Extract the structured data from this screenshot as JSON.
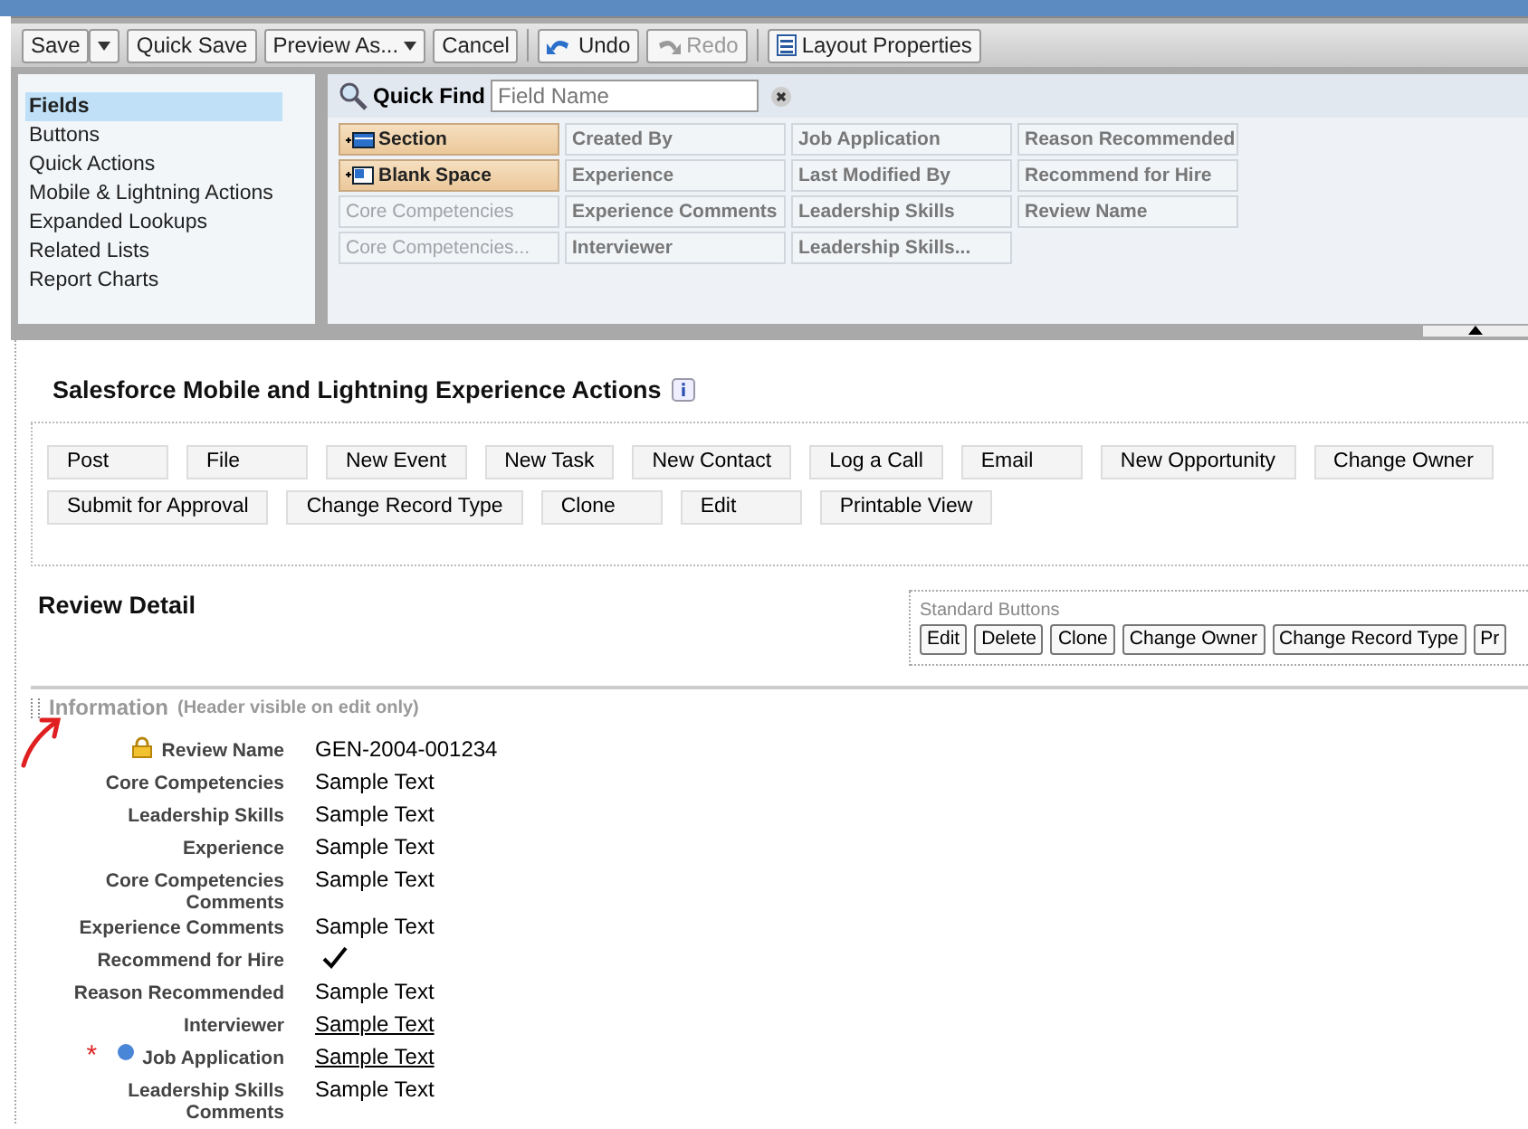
{
  "toolbar": [
    {
      "label": "Save",
      "kind": "split"
    },
    {
      "label": "Quick Save",
      "kind": "plain"
    },
    {
      "label": "Preview As...",
      "kind": "menu"
    },
    {
      "label": "Cancel",
      "kind": "plain"
    },
    {
      "label": "Undo",
      "kind": "undo",
      "disabled": false
    },
    {
      "label": "Redo",
      "kind": "redo",
      "disabled": true
    },
    {
      "label": "Layout Properties",
      "kind": "props"
    }
  ],
  "palette_categories": [
    {
      "label": "Fields",
      "selected": true
    },
    {
      "label": "Buttons",
      "selected": false
    },
    {
      "label": "Quick Actions",
      "selected": false
    },
    {
      "label": "Mobile & Lightning Actions",
      "selected": false
    },
    {
      "label": "Expanded Lookups",
      "selected": false
    },
    {
      "label": "Related Lists",
      "selected": false
    },
    {
      "label": "Report Charts",
      "selected": false
    }
  ],
  "quick_find": {
    "label": "Quick Find",
    "placeholder": "Field Name"
  },
  "palette_columns": [
    [
      {
        "label": "Section",
        "kind": "section",
        "used": false
      },
      {
        "label": "Blank Space",
        "kind": "blank",
        "used": false
      },
      {
        "label": "Core Competencies",
        "kind": "field",
        "used": true
      },
      {
        "label": "Core Competencies...",
        "kind": "field",
        "used": true
      }
    ],
    [
      {
        "label": "Created By",
        "kind": "field",
        "used": false
      },
      {
        "label": "Experience",
        "kind": "field",
        "used": false
      },
      {
        "label": "Experience Comments",
        "kind": "field",
        "used": false
      },
      {
        "label": "Interviewer",
        "kind": "field",
        "used": false
      }
    ],
    [
      {
        "label": "Job Application",
        "kind": "field",
        "used": false
      },
      {
        "label": "Last Modified By",
        "kind": "field",
        "used": false
      },
      {
        "label": "Leadership Skills",
        "kind": "field",
        "used": false
      },
      {
        "label": "Leadership Skills...",
        "kind": "field",
        "used": false
      }
    ],
    [
      {
        "label": "Reason Recommended",
        "kind": "field",
        "used": false
      },
      {
        "label": "Recommend for Hire",
        "kind": "field",
        "used": false
      },
      {
        "label": "Review Name",
        "kind": "field",
        "used": false
      }
    ]
  ],
  "actions": {
    "title": "Salesforce Mobile and Lightning Experience Actions",
    "buttons": [
      "Post",
      "File",
      "New Event",
      "New Task",
      "New Contact",
      "Log a Call",
      "Email",
      "New Opportunity",
      "Change Owner",
      "Submit for Approval",
      "Change Record Type",
      "Clone",
      "Edit",
      "Printable View"
    ]
  },
  "detail": {
    "title": "Review Detail",
    "standard_buttons_label": "Standard Buttons",
    "standard_buttons": [
      "Edit",
      "Delete",
      "Clone",
      "Change Owner",
      "Change Record Type",
      "Pr"
    ]
  },
  "section": {
    "title": "Information",
    "note": "(Header visible on edit only)"
  },
  "fields": [
    {
      "label": "Review Name",
      "value": "GEN-2004-001234",
      "kind": "text",
      "locked": true,
      "required": false
    },
    {
      "label": "Core Competencies",
      "value": "Sample Text",
      "kind": "text",
      "locked": false,
      "required": false
    },
    {
      "label": "Leadership Skills",
      "value": "Sample Text",
      "kind": "text",
      "locked": false,
      "required": false
    },
    {
      "label": "Experience",
      "value": "Sample Text",
      "kind": "text",
      "locked": false,
      "required": false
    },
    {
      "label": "Core Competencies Comments",
      "value": "Sample Text",
      "kind": "text",
      "locked": false,
      "required": false
    },
    {
      "label": "Experience Comments",
      "value": "Sample Text",
      "kind": "text",
      "locked": false,
      "required": false
    },
    {
      "label": "Recommend for Hire",
      "kind": "checkbox",
      "checked": true,
      "locked": false,
      "required": false
    },
    {
      "label": "Reason Recommended",
      "value": "Sample Text",
      "kind": "text",
      "locked": false,
      "required": false
    },
    {
      "label": "Interviewer",
      "value": "Sample Text",
      "kind": "link",
      "locked": false,
      "required": false
    },
    {
      "label": "Job Application",
      "value": "Sample Text",
      "kind": "link",
      "locked": false,
      "required": true,
      "required_mark": "*"
    },
    {
      "label": "Leadership Skills Comments",
      "value": "Sample Text",
      "kind": "text",
      "locked": false,
      "required": false
    }
  ]
}
